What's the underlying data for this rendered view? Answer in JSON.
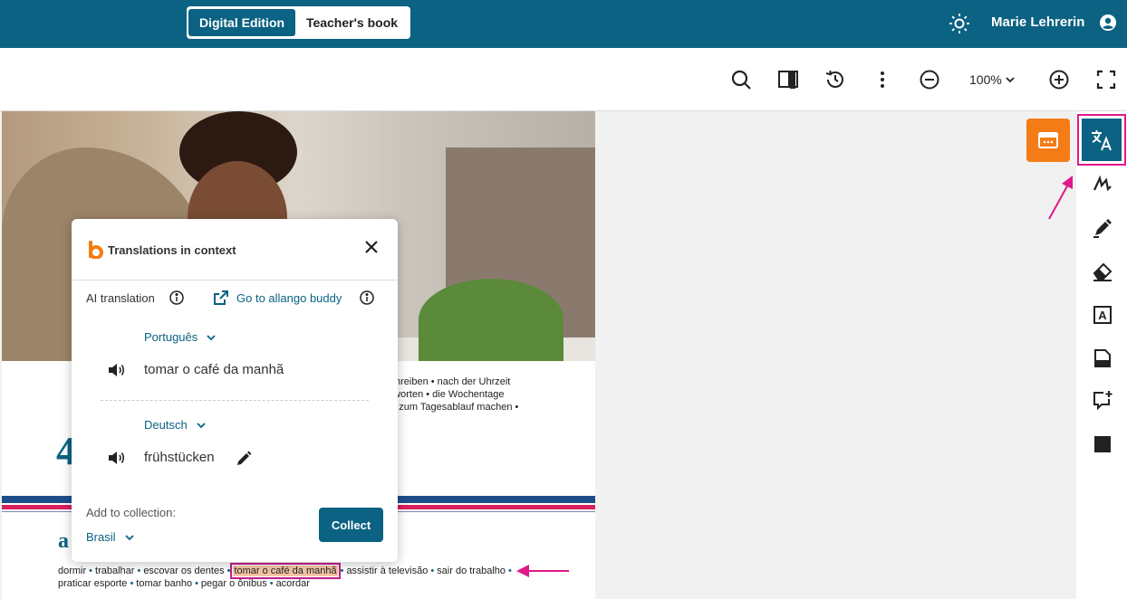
{
  "header": {
    "edition_tabs": [
      "Digital Edition",
      "Teacher's book"
    ],
    "active_tab": "Digital Edition",
    "user_name": "Marie Lehrerin",
    "icons": [
      "sun-icon",
      "user-icon"
    ]
  },
  "toolbar": {
    "zoom_level": "100%",
    "icons": [
      "search-icon",
      "book-icon",
      "history-icon",
      "more-icon",
      "zoom-out-icon",
      "zoom-in-icon",
      "fullscreen-icon"
    ]
  },
  "page": {
    "right_text": [
      "schreiben • nach der Uhrzeit",
      "ntworten • die Wochentage",
      "en zum Tagesablauf machen •"
    ],
    "big_number": "4",
    "section_letter": "a",
    "vocab_line1": [
      "dormir",
      "trabalhar",
      "escovar os dentes",
      "tomar o café da manhã",
      "assistir à televisão",
      "sair do trabalho"
    ],
    "vocab_line2": [
      "praticar esporte",
      "tomar banho",
      "pegar o ônibus",
      "acordar"
    ],
    "highlighted_word": "tomar o café da manhã"
  },
  "popup": {
    "title": "Translations in context",
    "ai_label": "AI translation",
    "buddy_link": "Go to allango buddy",
    "source_language": "Português",
    "source_text": "tomar o café da manhã",
    "target_language": "Deutsch",
    "target_text": "frühstücken",
    "collection_label": "Add to collection:",
    "collection_value": "Brasil",
    "collect_button": "Collect"
  },
  "sidebar": {
    "tools": [
      "widget-icon",
      "translate-icon",
      "pen-icon",
      "marker-icon",
      "eraser-icon",
      "textbox-icon",
      "sticky-note-icon",
      "comment-add-icon",
      "square-icon"
    ]
  },
  "colors": {
    "brand": "#0b6282",
    "accent_orange": "#f47c16",
    "highlight_border": "#e0198a"
  }
}
